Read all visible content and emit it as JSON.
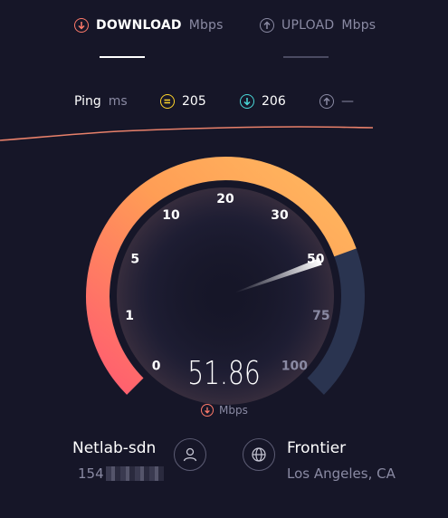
{
  "tabs": [
    {
      "label": "DOWNLOAD",
      "unit": "Mbps",
      "icon": "download-arrow-icon",
      "active": true
    },
    {
      "label": "UPLOAD",
      "unit": "Mbps",
      "icon": "upload-arrow-icon",
      "active": false
    }
  ],
  "ping": {
    "label": "Ping",
    "unit": "ms",
    "idle": "205",
    "download": "206",
    "upload": "—"
  },
  "gauge": {
    "ticks": [
      "0",
      "1",
      "5",
      "10",
      "20",
      "30",
      "50",
      "75",
      "100"
    ],
    "value_display": "51.86",
    "unit": "Mbps",
    "needle_value": 51.86
  },
  "client": {
    "name": "Netlab-sdn",
    "ip_prefix": "154"
  },
  "server": {
    "name": "Frontier",
    "location": "Los Angeles, CA"
  },
  "colors": {
    "background": "#161628",
    "accent_orange": "#ffa84a",
    "accent_pink": "#ff6a6a",
    "upload_track": "#2a3450",
    "ping_yellow": "#ffd42a",
    "ping_cyan": "#4ad8d8"
  }
}
